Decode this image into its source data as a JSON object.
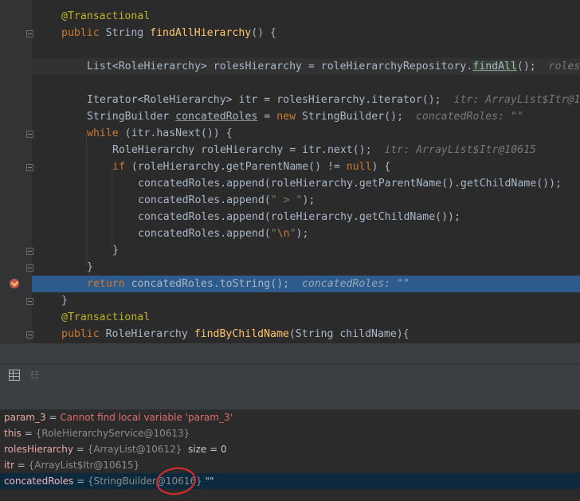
{
  "editor": {
    "lines": [
      {
        "annotation": "@Transactional"
      },
      {
        "kw": "public",
        "type": " String ",
        "method": "findAllHierarchy",
        "rest": "() {"
      },
      {},
      {
        "text": "List<RoleHierarchy> rolesHierarchy = roleHierarchyRepository.",
        "method": "findAll",
        "rest": "();",
        "hint": "roles"
      },
      {},
      {
        "text": "Iterator<RoleHierarchy> itr = rolesHierarchy.iterator();",
        "hint": "itr: ArrayList$Itr@1"
      },
      {
        "text1": "StringBuilder ",
        "var": "concatedRoles",
        "text2": " = ",
        "kw": "new",
        "text3": " StringBuilder();",
        "hint": "concatedRoles: \"\""
      },
      {
        "kw": "while",
        "rest": " (itr.hasNext()) {"
      },
      {
        "text": "RoleHierarchy roleHierarchy = itr.next();",
        "hint": "itr: ArrayList$Itr@10615"
      },
      {
        "kw": "if",
        "text": " (roleHierarchy.getParentName() != ",
        "kw2": "null",
        "rest": ") {"
      },
      {
        "text": "concatedRoles.append(roleHierarchy.getParentName().getChildName());"
      },
      {
        "text": "concatedRoles.append(",
        "str": "\" > \"",
        "rest": ");"
      },
      {
        "text": "concatedRoles.append(roleHierarchy.getChildName());"
      },
      {
        "text": "concatedRoles.append(",
        "str1": "\"",
        "esc": "\\n",
        "str2": "\"",
        "rest": ");"
      },
      {
        "text": "}"
      },
      {
        "text": "}"
      },
      {
        "kw": "return",
        "text": " concatedRoles.toString();",
        "hint": "concatedRoles: \"\""
      },
      {
        "text": "}"
      },
      {
        "annotation": "@Transactional"
      },
      {
        "kw": "public",
        "type": " RoleHierarchy ",
        "method": "findByChildName",
        "rest": "(String childName){"
      }
    ]
  },
  "variables": [
    {
      "name": "param_3",
      "eq": " = ",
      "error": "Cannot find local variable 'param_3'"
    },
    {
      "name": "this",
      "eq": " = ",
      "value": "{RoleHierarchyService@10613}"
    },
    {
      "name": "rolesHierarchy",
      "eq": " = ",
      "value": "{ArrayList@10612}",
      "extra": "  size = 0"
    },
    {
      "name": "itr",
      "eq": " = ",
      "value": "{ArrayList$Itr@10615}"
    },
    {
      "name": "concatedRoles",
      "eq": " = ",
      "value": "{StringBuilder@10616}",
      "extra": " \"\""
    }
  ],
  "icons": {
    "toolbar": [
      "table-grid-icon",
      "tree-view-icon"
    ],
    "gutter": [
      "breakpoint-icon",
      "fold-icon"
    ]
  },
  "colors": {
    "selection": "#2d5c8c",
    "annotation_circle": "#e32b2b"
  }
}
